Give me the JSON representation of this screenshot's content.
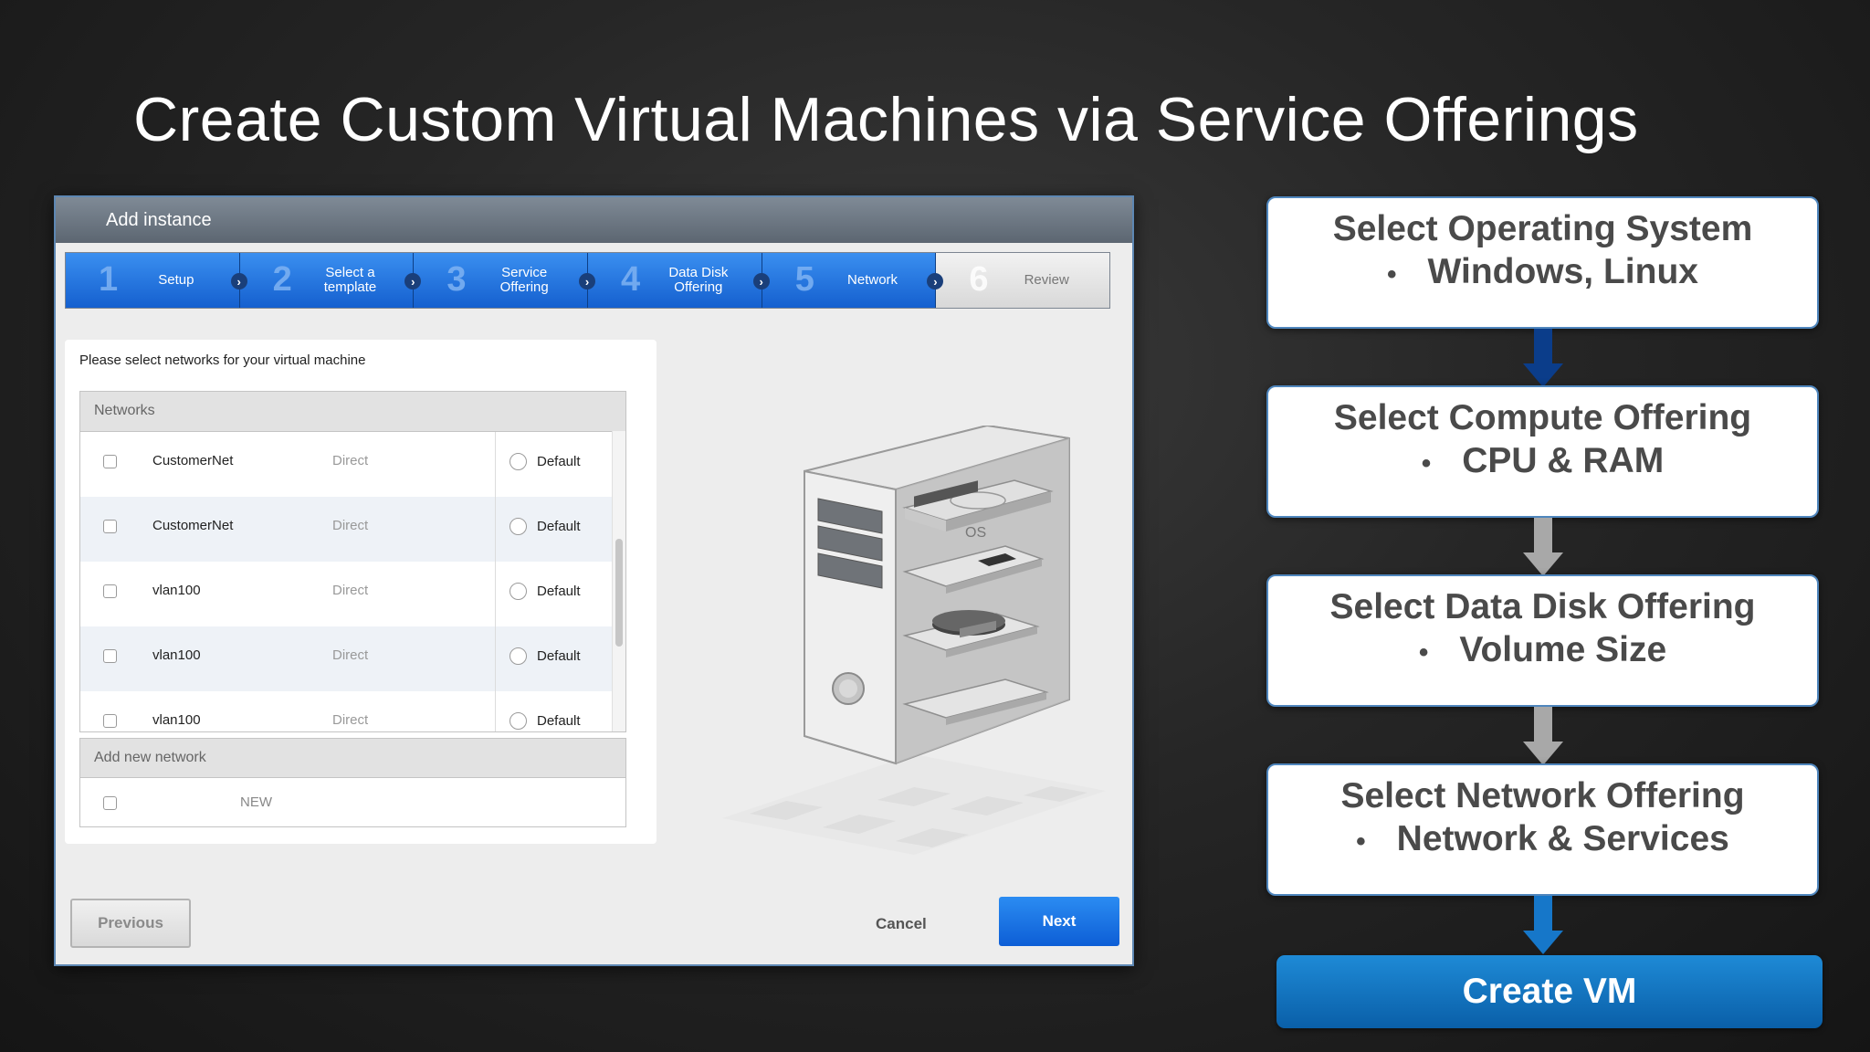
{
  "slide": {
    "title": "Create Custom Virtual Machines via Service Offerings"
  },
  "dialog": {
    "title": "Add instance",
    "steps": [
      {
        "num": "1",
        "label": "Setup",
        "active": true
      },
      {
        "num": "2",
        "label": "Select a template",
        "active": true
      },
      {
        "num": "3",
        "label": "Service Offering",
        "active": true
      },
      {
        "num": "4",
        "label": "Data Disk Offering",
        "active": true
      },
      {
        "num": "5",
        "label": "Network",
        "active": true
      },
      {
        "num": "6",
        "label": "Review",
        "active": false
      }
    ],
    "prompt": "Please select networks for your virtual machine",
    "networks_header": "Networks",
    "networks": [
      {
        "name": "CustomerNet",
        "type": "Direct",
        "default_label": "Default"
      },
      {
        "name": "CustomerNet",
        "type": "Direct",
        "default_label": "Default"
      },
      {
        "name": "vlan100",
        "type": "Direct",
        "default_label": "Default"
      },
      {
        "name": "vlan100",
        "type": "Direct",
        "default_label": "Default"
      },
      {
        "name": "vlan100",
        "type": "Direct",
        "default_label": "Default"
      }
    ],
    "add_network_header": "Add new network",
    "new_label": "NEW",
    "illustration_label": "OS",
    "buttons": {
      "previous": "Previous",
      "cancel": "Cancel",
      "next": "Next"
    }
  },
  "flow": {
    "steps": [
      {
        "title": "Select Operating System",
        "detail": "Windows, Linux"
      },
      {
        "title": "Select Compute Offering",
        "detail": "CPU & RAM"
      },
      {
        "title": "Select Data Disk Offering",
        "detail": "Volume Size"
      },
      {
        "title": "Select Network Offering",
        "detail": "Network & Services"
      }
    ],
    "bullet": "•",
    "final": "Create VM"
  },
  "colors": {
    "wizard_active": "#1a6ee0",
    "box_border": "#4f86bd",
    "create_vm": "#0e6fbf",
    "arrow_dark_blue": "#0b3d8a",
    "arrow_gray": "#a8a8a8",
    "arrow_blue": "#1677c9"
  }
}
